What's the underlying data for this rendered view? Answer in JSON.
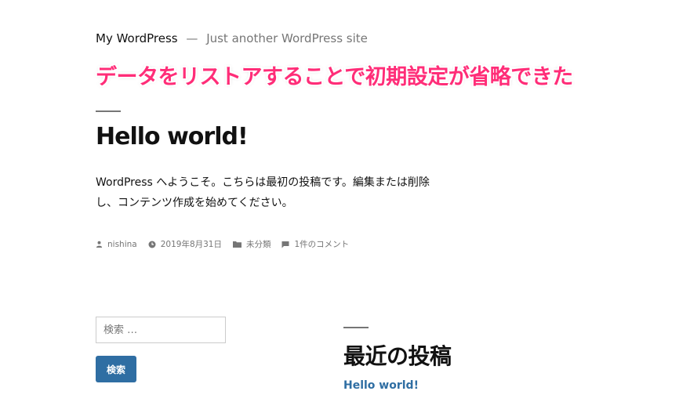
{
  "header": {
    "site_title": "My WordPress",
    "separator": "—",
    "tagline": "Just another WordPress site"
  },
  "overlay_caption": "データをリストアすることで初期設定が省略できた",
  "post": {
    "title": "Hello world!",
    "content": "WordPress へようこそ。こちらは最初の投稿です。編集または削除し、コンテンツ作成を始めてください。",
    "meta": {
      "author": "nishina",
      "date": "2019年8月31日",
      "category": "未分類",
      "comments": "1件のコメント"
    }
  },
  "search": {
    "placeholder": "検索 …",
    "button_label": "検索"
  },
  "recent_posts": {
    "heading": "最近の投稿",
    "items": [
      {
        "label": "Hello world!"
      }
    ]
  },
  "colors": {
    "link": "#2f6ea3",
    "overlay_text": "#ff2d78",
    "muted": "#767676"
  },
  "icons": {
    "author": "person-icon",
    "date": "clock-icon",
    "category": "folder-icon",
    "comments": "comment-icon"
  }
}
